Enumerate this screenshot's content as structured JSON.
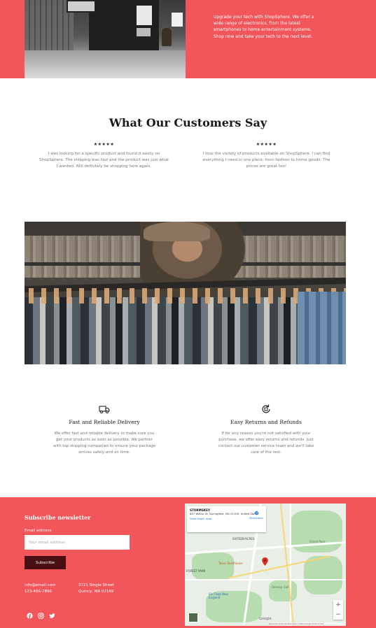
{
  "hero": {
    "text": "Upgrade your tech with ShopSphere. We offer a wide range of electronics, from the latest smartphones to home entertainment systems. Shop now and take your tech to the next level."
  },
  "testimonials": {
    "title": "What Our Customers Say",
    "reviews": [
      {
        "stars": "★★★★★",
        "text": "I was looking for a specific product and found it easily on ShopSphere. The shipping was fast and the product was just what I wanted. Will definitely be shopping here again."
      },
      {
        "stars": "★★★★★",
        "text": "I love the variety of products available on ShopSphere. I can find everything I need in one place, from fashion to home goods. The prices are great too!"
      }
    ]
  },
  "features": [
    {
      "icon": "truck-icon",
      "title": "Fast and Reliable Delivery",
      "text": "We offer fast and reliable delivery to make sure you get your products as soon as possible. We partner with top shipping companies to ensure your package arrives safely and on time."
    },
    {
      "icon": "return-icon",
      "title": "Easy Returns and Refunds",
      "text": "If for any reason you're not satisfied with your purchase, we offer easy returns and refunds. Just contact our customer service team and we'll take care of the rest."
    }
  ],
  "footer": {
    "subscribe_title": "Subscribe newsletter",
    "email_label": "Email address",
    "email_placeholder": "Your email address",
    "subscribe_button": "Subscribe",
    "email": "info@email.com",
    "phone": "123-456-7890",
    "address_line1": "3721 Single Street",
    "address_line2": "Quincy, MA 02169",
    "socials": [
      "facebook-icon",
      "instagram-icon",
      "twitter-icon"
    ]
  },
  "map": {
    "place_name": "STORMSKEY",
    "place_address": "647 Wilbur St, Springfield, MA 01109, United States",
    "view_larger": "View larger map",
    "directions": "Directions",
    "labels": {
      "area": "SIXTEEN ACRES",
      "forest": "FOREST PARK",
      "texas": "Texas Roadhouse",
      "park": "Forest Park",
      "fairway": "Fairway Golf",
      "sixflags": "Six Flags New England",
      "mapdata": "Map data ©2024 Google",
      "credits": "Keyboard shortcuts   Map data ©2024 Google   Terms of Use",
      "google": "Google"
    },
    "accent_color": "#d93025"
  },
  "colors": {
    "brand": "#f2565a",
    "button_dark": "#4a0f12"
  }
}
